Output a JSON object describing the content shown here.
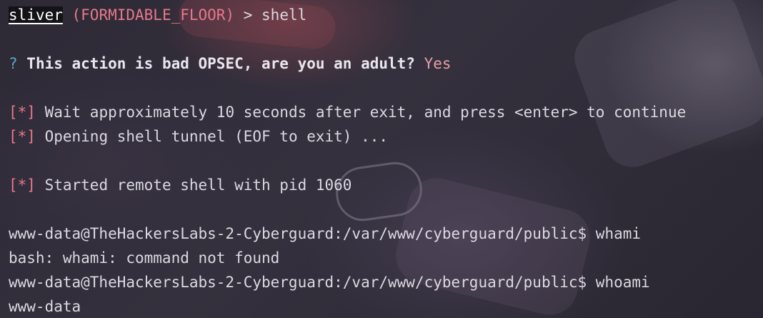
{
  "prompt": {
    "name": "sliver",
    "session": "(FORMIDABLE_FLOOR)",
    "separator": " > ",
    "command": "shell"
  },
  "confirm": {
    "mark": "?",
    "question": " This action is bad OPSEC, are you an adult?",
    "answer": " Yes"
  },
  "info": {
    "marker": "[*]",
    "wait": " Wait approximately 10 seconds after exit, and press <enter> to continue",
    "opening": " Opening shell tunnel (EOF to exit) ...",
    "started": " Started remote shell with pid 1060"
  },
  "shell": {
    "line1": "www-data@TheHackersLabs-2-Cyberguard:/var/www/cyberguard/public$ whami",
    "line2": "bash: whami: command not found",
    "line3": "www-data@TheHackersLabs-2-Cyberguard:/var/www/cyberguard/public$ whoami",
    "line4": "www-data"
  }
}
